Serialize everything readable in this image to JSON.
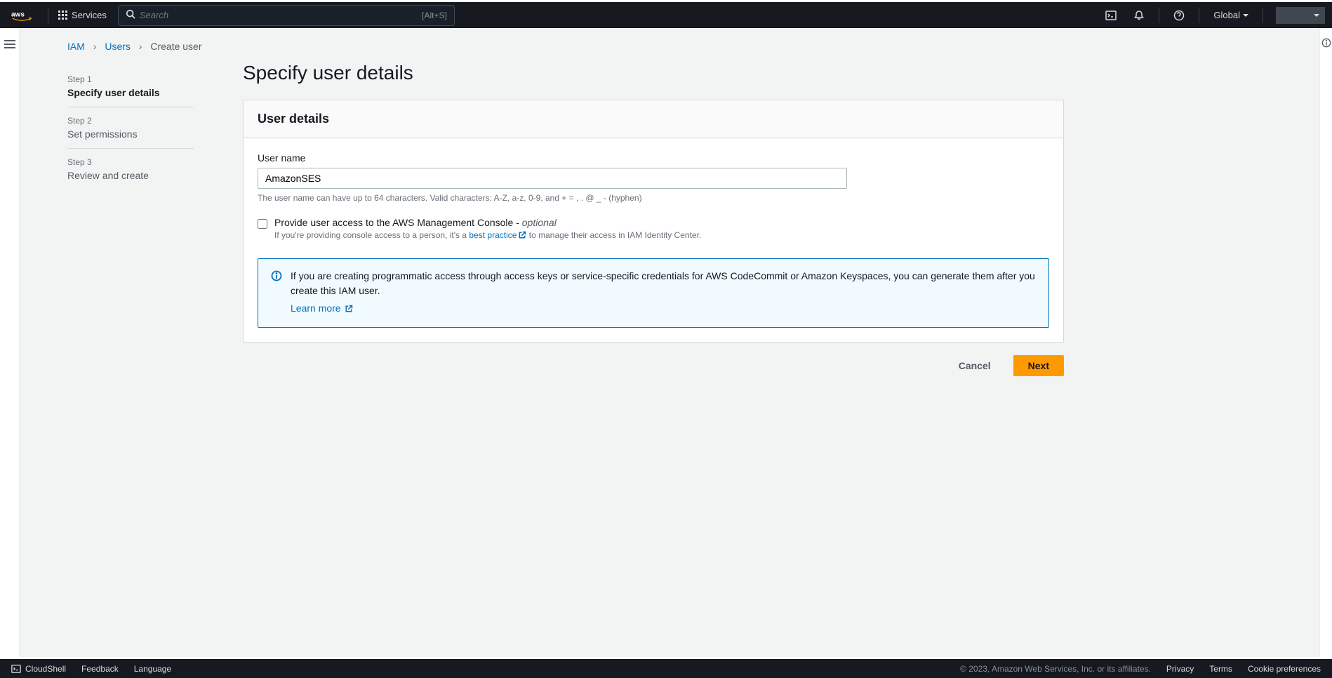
{
  "nav": {
    "services_label": "Services",
    "search_placeholder": "Search",
    "search_kbd": "[Alt+S]",
    "region": "Global"
  },
  "breadcrumb": {
    "iam": "IAM",
    "users": "Users",
    "current": "Create user"
  },
  "steps": [
    {
      "n": "Step 1",
      "t": "Specify user details"
    },
    {
      "n": "Step 2",
      "t": "Set permissions"
    },
    {
      "n": "Step 3",
      "t": "Review and create"
    }
  ],
  "page_title": "Specify user details",
  "panel": {
    "heading": "User details",
    "username_label": "User name",
    "username_value": "AmazonSES",
    "username_hint": "The user name can have up to 64 characters. Valid characters: A-Z, a-z, 0-9, and + = , . @ _ - (hyphen)",
    "checkbox_label_main": "Provide user access to the AWS Management Console - ",
    "checkbox_label_opt": "optional",
    "checkbox_desc_pre": "If you're providing console access to a person, it's a ",
    "checkbox_desc_link": "best practice",
    "checkbox_desc_post": " to manage their access in IAM Identity Center.",
    "info_text": "If you are creating programmatic access through access keys or service-specific credentials for AWS CodeCommit or Amazon Keyspaces, you can generate them after you create this IAM user.",
    "learn_more": "Learn more"
  },
  "buttons": {
    "cancel": "Cancel",
    "next": "Next"
  },
  "footer": {
    "cloudshell": "CloudShell",
    "feedback": "Feedback",
    "language": "Language",
    "copyright": "© 2023, Amazon Web Services, Inc. or its affiliates.",
    "privacy": "Privacy",
    "terms": "Terms",
    "cookies": "Cookie preferences"
  }
}
